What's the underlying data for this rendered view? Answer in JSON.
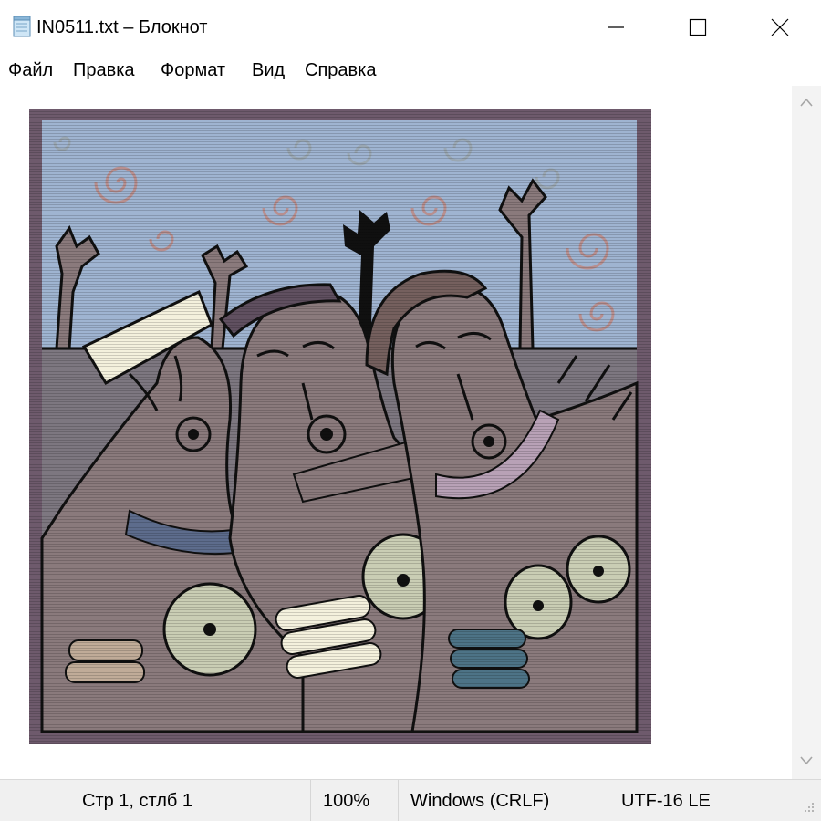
{
  "window": {
    "title": "IN0511.txt – Блокнот",
    "icons": {
      "app": "notepad-icon",
      "minimize": "minimize-icon",
      "maximize": "maximize-icon",
      "close": "close-icon"
    }
  },
  "menu": {
    "items": [
      "Файл",
      "Правка",
      "Формат",
      "Вид",
      "Справка"
    ]
  },
  "editor": {
    "content_image": "three-women-illustration"
  },
  "status": {
    "position": "Стр 1, стлб 1",
    "zoom": "100%",
    "line_endings": "Windows (CRLF)",
    "encoding": "UTF-16 LE"
  },
  "colors": {
    "sky": "#9fb4d1",
    "ground": "#7d7780",
    "skin": "#8a7a7c",
    "frame": "#6e5a6c",
    "cream": "#f4f1dd",
    "bangle_teal": "#4d7386",
    "outline": "#101010"
  }
}
